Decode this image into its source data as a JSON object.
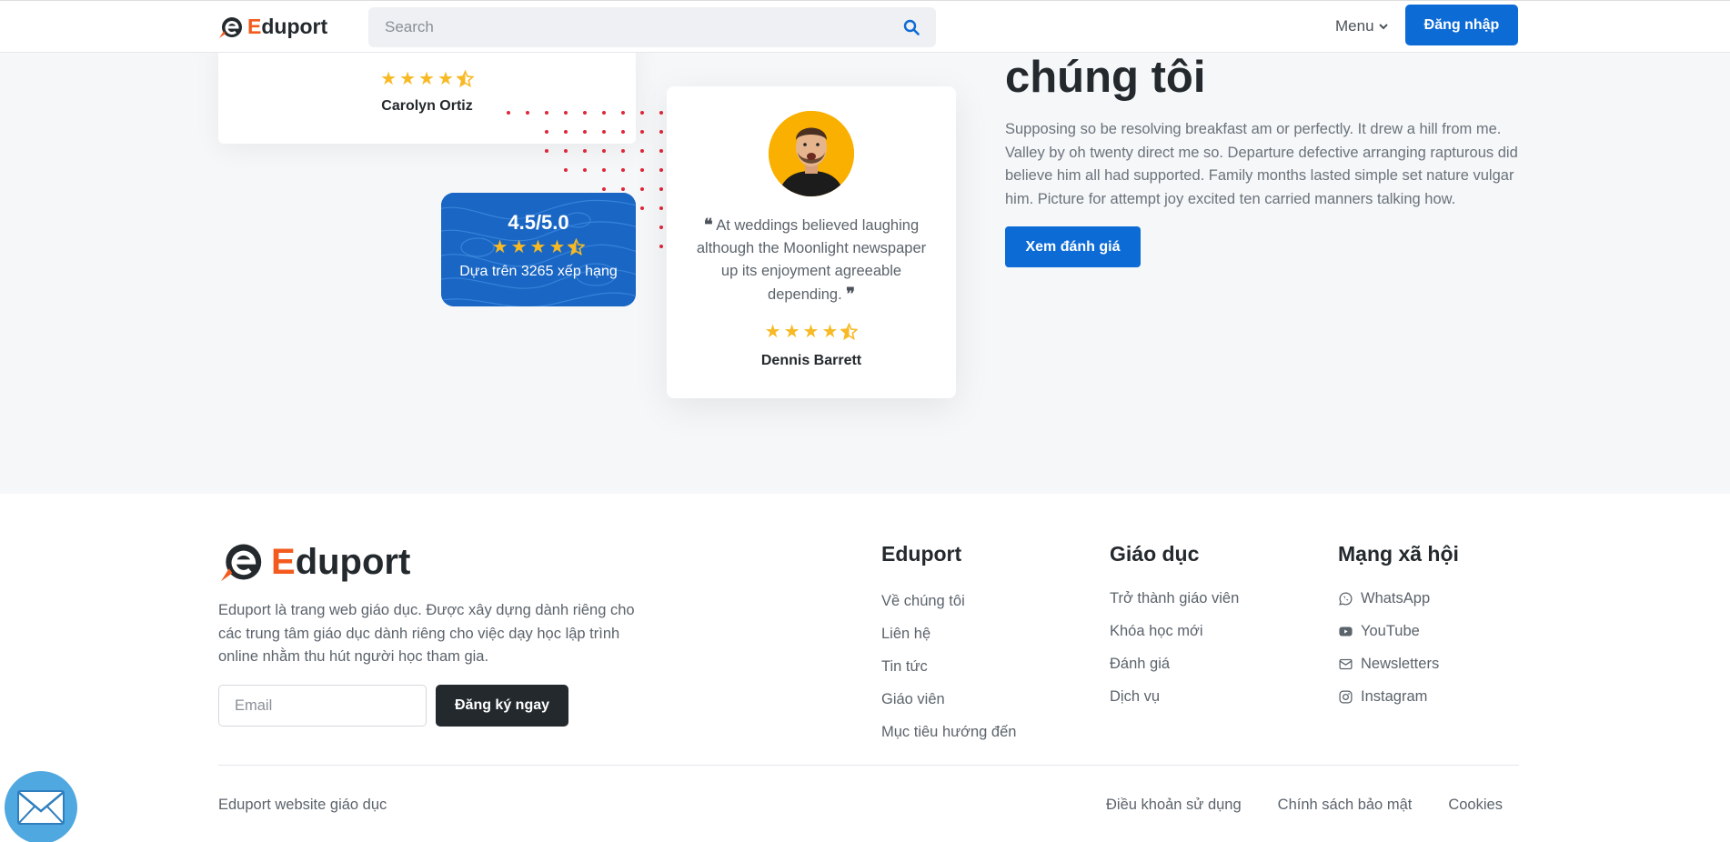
{
  "header": {
    "brand_initial": "E",
    "brand_rest": "duport",
    "search_placeholder": "Search",
    "menu_label": "Menu",
    "login_label": "Đăng nhập"
  },
  "testimonials": {
    "top_card": {
      "name": "Carolyn Ortiz",
      "rating": 4.5
    },
    "rating_badge": {
      "score": "4.5/5.0",
      "rating": 4.5,
      "caption": "Dựa trên 3265 xếp hạng"
    },
    "main_card": {
      "quote": "At weddings believed laughing although the Moonlight newspaper up its enjoyment agreeable depending.",
      "open_quote": "❝",
      "close_quote": "❞",
      "rating": 4.5,
      "name": "Dennis Barrett"
    }
  },
  "about": {
    "heading": "chúng tôi",
    "paragraph": "Supposing so be resolving breakfast am or perfectly. It drew a hill from me. Valley by oh twenty direct me so. Departure defective arranging rapturous did believe him all had supported. Family months lasted simple set nature vulgar him. Picture for attempt joy excited ten carried manners talking how.",
    "button_label": "Xem đánh giá"
  },
  "footer": {
    "brand_initial": "E",
    "brand_rest": "duport",
    "description": "Eduport là trang web giáo dục. Được xây dựng dành riêng cho các trung tâm giáo dục dành riêng cho việc dạy học lập trình online nhằm thu hút người học tham gia.",
    "email_placeholder": "Email",
    "subscribe_label": "Đăng ký ngay",
    "columns": [
      {
        "title": "Eduport",
        "links": [
          "Về chúng tôi",
          "Liên hệ",
          "Tin tức",
          "Giáo viên",
          "Mục tiêu hướng đến"
        ]
      },
      {
        "title": "Giáo dục",
        "links": [
          "Trở thành giáo viên",
          "Khóa học mới",
          "Đánh giá",
          "Dịch vụ"
        ]
      },
      {
        "title": "Mạng xã hội",
        "links": [
          {
            "label": "WhatsApp",
            "icon": "whatsapp-icon"
          },
          {
            "label": "YouTube",
            "icon": "youtube-icon"
          },
          {
            "label": "Newsletters",
            "icon": "envelope-icon"
          },
          {
            "label": "Instagram",
            "icon": "instagram-icon"
          }
        ]
      }
    ],
    "copyright": "Eduport website giáo dục",
    "bottom_links": [
      "Điều khoản sử dụng",
      "Chính sách bảo mật",
      "Cookies"
    ]
  },
  "colors": {
    "primary": "#0d6bd6",
    "accent": "#f25b1d",
    "star": "#f7b924",
    "dark": "#24292d"
  }
}
